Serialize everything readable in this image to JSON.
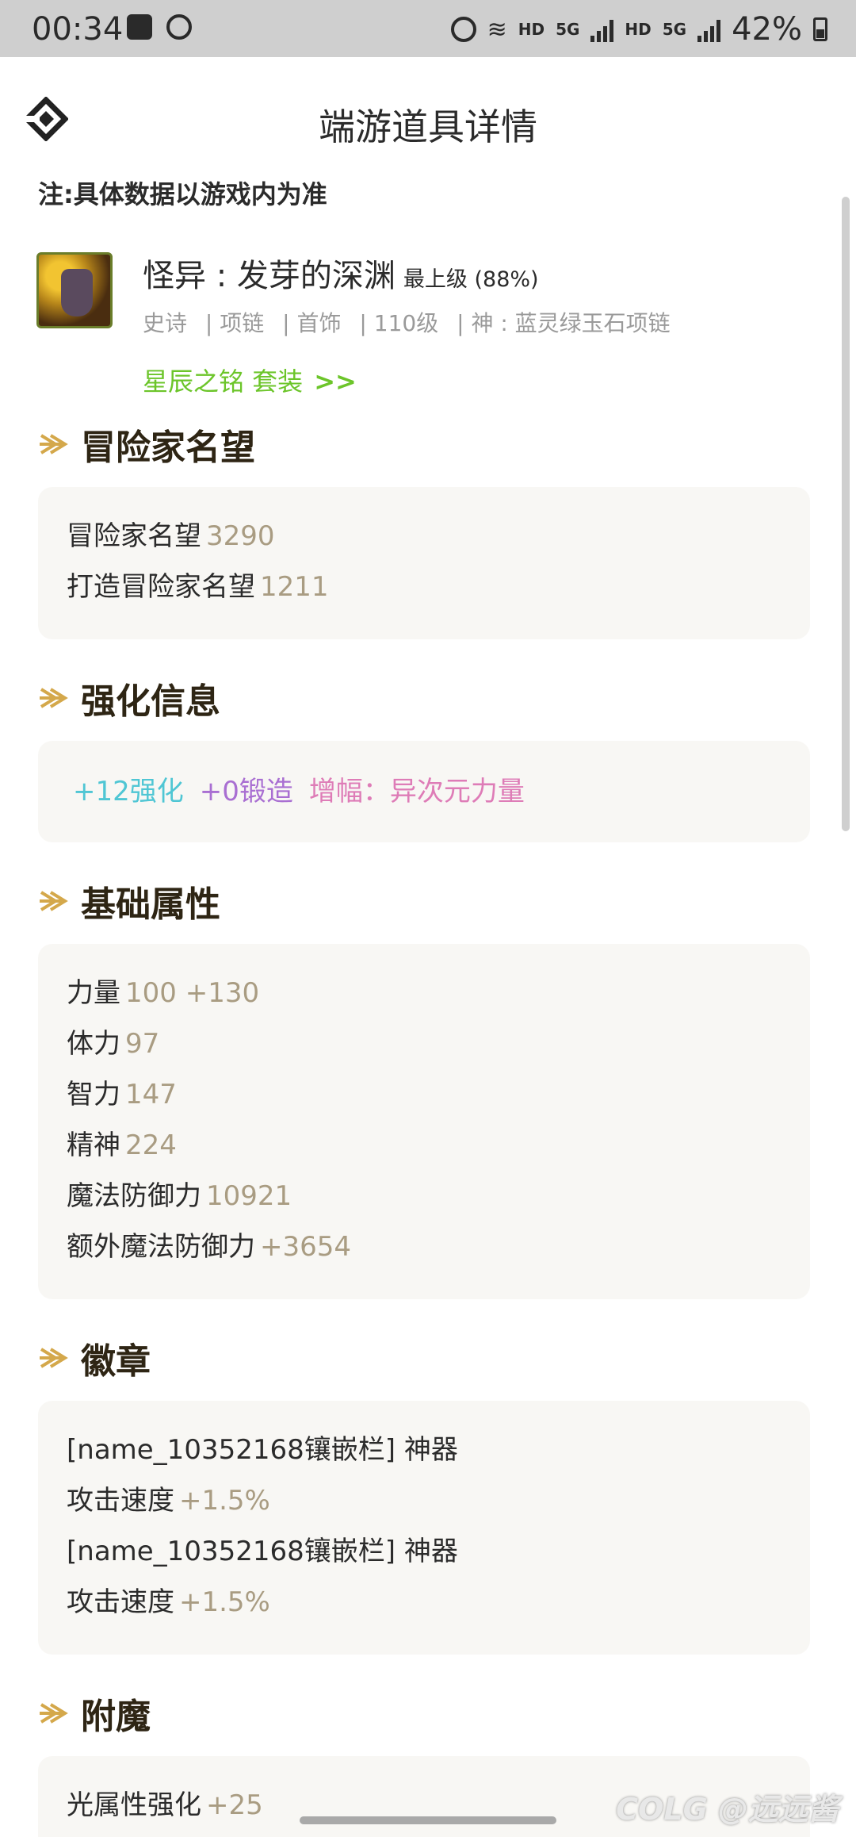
{
  "status_bar": {
    "time": "00:34",
    "network_labels": [
      "HD",
      "5G",
      "HD",
      "5G"
    ],
    "battery": "42%"
  },
  "header": {
    "title": "端游道具详情"
  },
  "notice": "注:具体数据以游戏内为准",
  "item": {
    "name": "怪异 : 发芽的深渊",
    "grade": "最上级 (88%)",
    "tags": [
      "史诗",
      "| 项链",
      "| 首饰",
      "| 110级",
      "| 神 : 蓝灵绿玉石项链"
    ],
    "set_link": "星辰之铭 套装",
    "set_link_arrow": ">>"
  },
  "sections": {
    "reputation": {
      "title": "冒险家名望",
      "rows": [
        {
          "label": "冒险家名望",
          "value": "3290"
        },
        {
          "label": "打造冒险家名望",
          "value": "1211"
        }
      ]
    },
    "enhance": {
      "title": "强化信息",
      "reinforce": "+12强化",
      "forge": "+0锻造",
      "amplify": "增幅：异次元力量"
    },
    "base": {
      "title": "基础属性",
      "rows": [
        {
          "label": "力量",
          "value": "100 +130"
        },
        {
          "label": "体力",
          "value": "97"
        },
        {
          "label": "智力",
          "value": "147"
        },
        {
          "label": "精神",
          "value": "224"
        },
        {
          "label": "魔法防御力",
          "value": "10921"
        },
        {
          "label": "额外魔法防御力",
          "value": "+3654"
        }
      ]
    },
    "emblem": {
      "title": "徽章",
      "rows": [
        {
          "label": "[name_10352168镶嵌栏] 神器",
          "value": ""
        },
        {
          "label": "攻击速度",
          "value": "+1.5%"
        },
        {
          "label": "[name_10352168镶嵌栏] 神器",
          "value": ""
        },
        {
          "label": "攻击速度",
          "value": "+1.5%"
        }
      ]
    },
    "enchant": {
      "title": "附魔",
      "rows": [
        {
          "label": "光属性强化",
          "value": "+25"
        }
      ]
    }
  },
  "watermark": "COLG @远远酱",
  "colors": {
    "accent_gold": "#d4a84b",
    "value_tan": "#a99c82",
    "set_green": "#6cc52a",
    "reinforce_cyan": "#4fc6d4",
    "forge_purple": "#a96fd2",
    "amplify_pink": "#de7cb7"
  }
}
